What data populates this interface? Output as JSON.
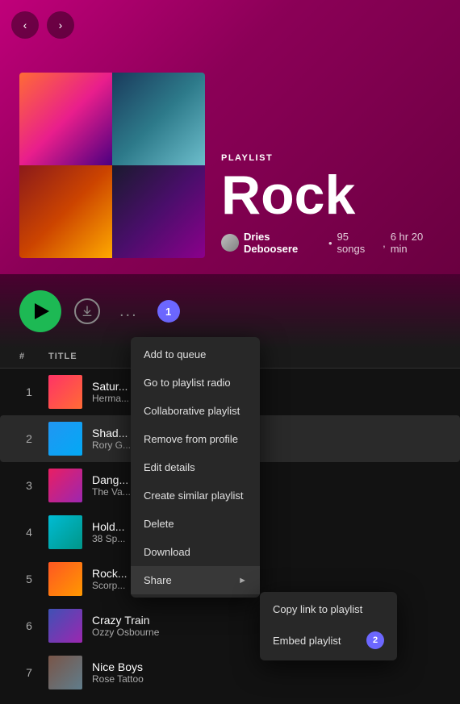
{
  "nav": {
    "back_label": "‹",
    "forward_label": "›"
  },
  "playlist": {
    "label": "PLAYLIST",
    "title": "Rock",
    "owner": "Dries Deboosere",
    "song_count": "95 songs",
    "duration": "6 hr 20 min",
    "separator": "•"
  },
  "controls": {
    "play_label": "Play",
    "download_label": "Download",
    "more_label": "...",
    "badge1": "1"
  },
  "table_header": {
    "num": "#",
    "title": "TITLE"
  },
  "tracks": [
    {
      "num": "1",
      "name": "Satur...",
      "artist": "Herma...",
      "art_class": "track-ta"
    },
    {
      "num": "2",
      "name": "Shad...",
      "artist": "Rory G...",
      "art_class": "track-tb"
    },
    {
      "num": "3",
      "name": "Dang...",
      "artist": "The Va...",
      "art_class": "track-tc"
    },
    {
      "num": "4",
      "name": "Hold...",
      "artist": "38 Sp...",
      "art_class": "track-td"
    },
    {
      "num": "5",
      "name": "Rock...",
      "artist": "Scorp...",
      "art_class": "track-te"
    },
    {
      "num": "6",
      "name": "Crazy Train",
      "artist": "Ozzy Osbourne",
      "art_class": "track-tf"
    },
    {
      "num": "7",
      "name": "Nice Boys",
      "artist": "Rose Tattoo",
      "art_class": "track-tg"
    }
  ],
  "context_menu": {
    "items": [
      {
        "id": "add-to-queue",
        "label": "Add to queue",
        "has_sub": false
      },
      {
        "id": "go-to-radio",
        "label": "Go to playlist radio",
        "has_sub": false
      },
      {
        "id": "collaborative",
        "label": "Collaborative playlist",
        "has_sub": false
      },
      {
        "id": "remove-profile",
        "label": "Remove from profile",
        "has_sub": false
      },
      {
        "id": "edit-details",
        "label": "Edit details",
        "has_sub": false
      },
      {
        "id": "create-similar",
        "label": "Create similar playlist",
        "has_sub": false
      },
      {
        "id": "delete",
        "label": "Delete",
        "has_sub": false
      },
      {
        "id": "download",
        "label": "Download",
        "has_sub": false
      },
      {
        "id": "share",
        "label": "Share",
        "has_sub": true
      }
    ]
  },
  "share_submenu": {
    "items": [
      {
        "id": "copy-link",
        "label": "Copy link to playlist",
        "has_badge": false
      },
      {
        "id": "embed",
        "label": "Embed playlist",
        "has_badge": true,
        "badge": "2"
      }
    ]
  }
}
